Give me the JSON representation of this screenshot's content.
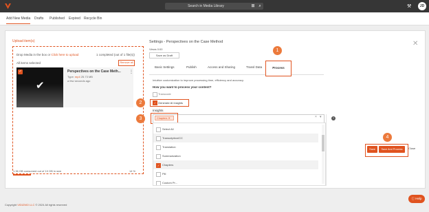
{
  "header": {
    "search_placeholder": "Search in Media Library",
    "avatar_initials": "JD"
  },
  "nav_tabs": [
    "Add New Media",
    "Drafts",
    "Published",
    "Expired",
    "Recycle Bin"
  ],
  "upload": {
    "title": "Upload item(s)",
    "drop_text": "Drop Media in the box or",
    "drop_link": "Click here to upload",
    "completed": "1 completed (out of 1 file(s))",
    "all_selected": "All items selected",
    "remove_all": "Remove all",
    "item": {
      "title": "Perspectives on the Case Meth...",
      "type_label": "Type:",
      "type_value": "mp4",
      "size": "25.73 MB",
      "time": "a few seconds ago"
    },
    "storage_text": "1.36 GB consumed out of 10 GB in size",
    "storage_pct": "14 %",
    "storage_fraction": 0.14
  },
  "settings": {
    "title": "Settings - Perspectives on the Case Method",
    "views": "Views    0:00",
    "save_as_draft": "Save as Draft",
    "tabs": [
      "Basic Settings",
      "Publish",
      "Access and Sharing",
      "Transl Data",
      "Process"
    ],
    "active_tab": "Process",
    "info": "Intuitive customization to improve processing time, efficiency and accuracy.",
    "question": "How you want to process your content?",
    "options": {
      "transcode": "Transcode",
      "generate_ai": "Generate AI insights"
    },
    "insights_label": "Insights",
    "chip": "Chapters",
    "dropdown_items": [
      {
        "label": "Select All",
        "checked": false
      },
      {
        "label": "Transcription/CC",
        "checked": false
      },
      {
        "label": "Translation",
        "checked": false
      },
      {
        "label": "Summarization",
        "checked": false
      },
      {
        "label": "Chapters",
        "checked": true
      },
      {
        "label": "Pill",
        "checked": false
      },
      {
        "label": "Custom Pr...",
        "checked": false
      }
    ],
    "buttons": {
      "save": "Save",
      "save_and_process": "Save And Process",
      "close": "Close"
    }
  },
  "steps": [
    "1",
    "2",
    "3",
    "4"
  ],
  "footer": {
    "prefix": "Copyright",
    "brand": "VIDIZMO LLC",
    "suffix": "© 2024 All rights reserved"
  },
  "help_button": "Help",
  "colors": {
    "accent": "#e0531f",
    "step": "#ec7a3c",
    "topbar": "#363636"
  }
}
